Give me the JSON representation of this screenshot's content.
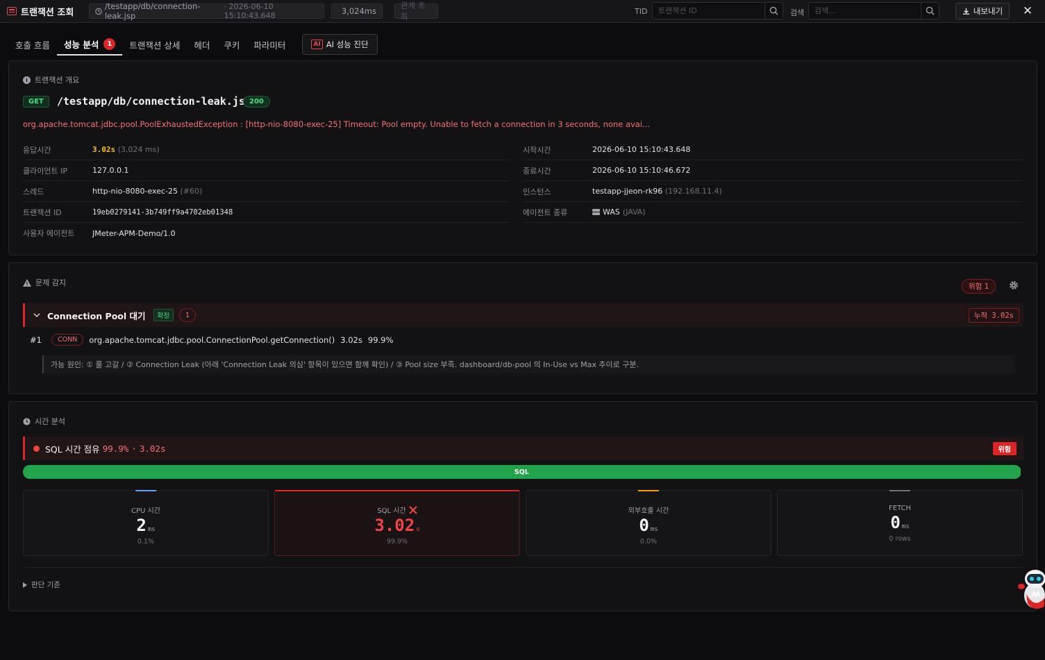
{
  "header": {
    "title": "트랜잭션 조회",
    "path": "/testapp/db/connection-leak.jsp",
    "path_time": "· 2026-06-10 15:10:43.648",
    "elapsed": "3,024ms",
    "related_label": "관계 조회",
    "tid_label": "TID",
    "tid_placeholder": "트랜잭션 ID",
    "search_label": "검색",
    "search_placeholder": "검색...",
    "export_label": "내보내기",
    "close_label": "✕"
  },
  "tabs": [
    {
      "label": "호출 흐름"
    },
    {
      "label": "성능 분석",
      "badge": "1"
    },
    {
      "label": "트랜잭션 상세"
    },
    {
      "label": "헤더"
    },
    {
      "label": "쿠키"
    },
    {
      "label": "파라미터"
    }
  ],
  "ai_button": {
    "icon": "AI",
    "label": "AI 성능 진단"
  },
  "overview": {
    "heading": "트랜잭션 개요",
    "method": "GET",
    "url": "/testapp/db/connection-leak.jsp",
    "status": "200",
    "error": "org.apache.tomcat.jdbc.pool.PoolExhaustedException : [http-nio-8080-exec-25] Timeout: Pool empty. Unable to fetch a connection in 3 seconds, none avai...",
    "fields": {
      "response_label": "응답시간",
      "response_value": "3.02s",
      "response_extra": "(3,024 ms)",
      "client_label": "클라이언트 IP",
      "client_value": "127.0.0.1",
      "thread_label": "스레드",
      "thread_value": "http-nio-8080-exec-25",
      "thread_extra": "(#60)",
      "txid_label": "트랜잭션 ID",
      "txid_value": "19eb0279141-3b749ff9a4702eb01348",
      "ua_label": "사용자 에이전트",
      "ua_value": "JMeter-APM-Demo/1.0",
      "start_label": "시작시간",
      "start_value": "2026-06-10 15:10:43.648",
      "end_label": "종료시간",
      "end_value": "2026-06-10 15:10:46.672",
      "instance_label": "인스턴스",
      "instance_value": "testapp-jjeon-rk96",
      "instance_extra": "(192.168.11.4)",
      "agent_label": "에이전트 종류",
      "agent_value": "WAS",
      "agent_extra": "(JAVA)"
    }
  },
  "issues": {
    "heading": "문제 감지",
    "risk_pill": "위험 1",
    "item": {
      "title": "Connection Pool 대기",
      "tag": "확정",
      "count": "1",
      "cumulative": "누적 3.02s",
      "evidence_index": "#1",
      "evidence_tag": "CONN",
      "evidence_method": "org.apache.tomcat.jdbc.pool.ConnectionPool.getConnection()",
      "evidence_time": "3.02s",
      "evidence_pct": "99.9%",
      "cause": "가능 원인: ① 풀 고갈 / ② Connection Leak (아래 'Connection Leak 의심' 항목이 있으면 함께 확인) / ③ Pool size 부족. dashboard/db-pool 의 In-Use vs Max 추이로 구분."
    }
  },
  "time": {
    "heading": "시간 분석",
    "alert_text": "SQL 시간 점유",
    "alert_pct": "99.9%",
    "alert_sep": "·",
    "alert_time": "3.02s",
    "risk_tag": "위험",
    "bar_label": "SQL",
    "bar_fraction": 0.999,
    "metrics": [
      {
        "label": "CPU 시간",
        "value": "2",
        "unit": "ms",
        "sub": "0.1%",
        "accent": "#60a5fa"
      },
      {
        "label": "SQL 시간",
        "value": "3.02",
        "unit": "s",
        "sub": "99.9%",
        "accent": "#dc2626"
      },
      {
        "label": "외부호출 시간",
        "value": "0",
        "unit": "ms",
        "sub": "0.0%",
        "accent": "#f59e0b"
      },
      {
        "label": "FETCH",
        "value": "0",
        "unit": "ms",
        "sub": "0 rows",
        "accent": "#71717a"
      }
    ],
    "judge_label": "판단 기준"
  }
}
